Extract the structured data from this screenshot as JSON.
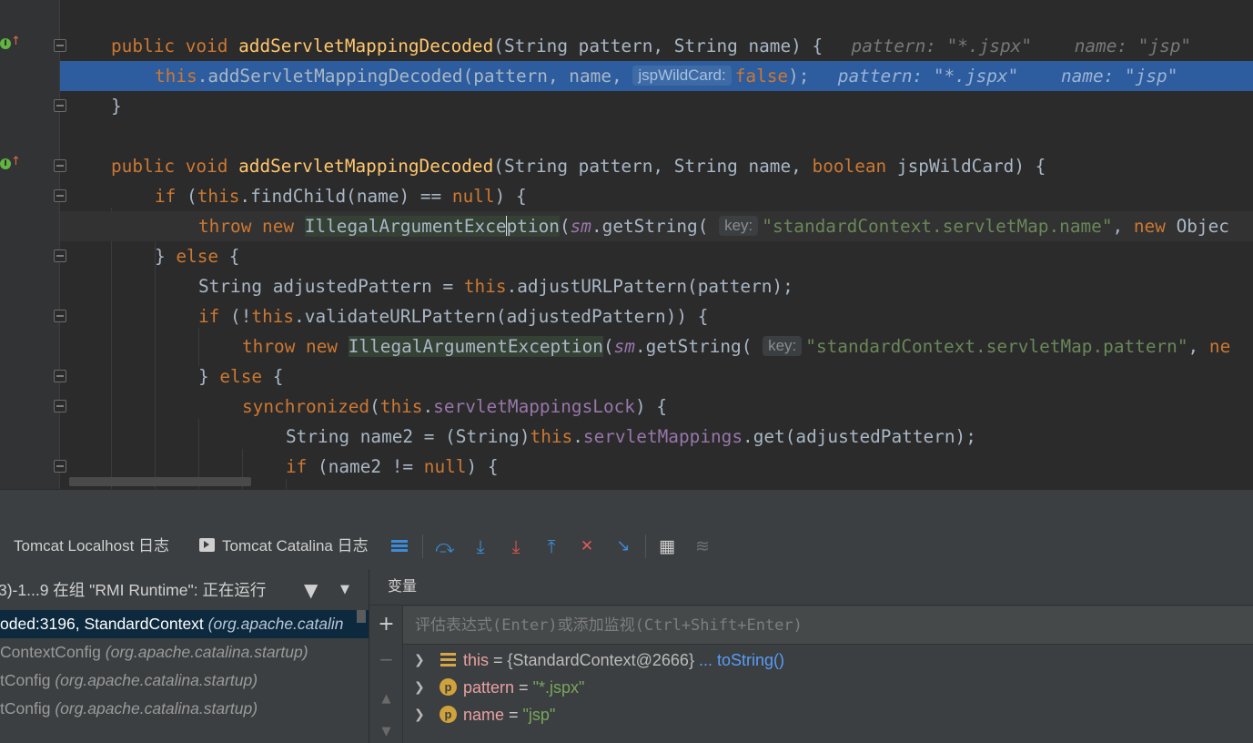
{
  "editor": {
    "lines": [
      {
        "parts": [
          [
            "kw",
            "public void "
          ],
          [
            "fn",
            "addServletMappingDecoded"
          ],
          [
            "",
            "(String pattern, String name) {  "
          ],
          [
            "inline",
            "pattern: \"*.jspx\"    name: \"jsp\""
          ]
        ]
      },
      {
        "parts": [
          [
            "kw",
            "this"
          ],
          [
            "",
            "."
          ],
          [
            "",
            "addServletMappingDecoded(pattern, name, "
          ],
          [
            "hint",
            "jspWildCard:"
          ],
          [
            "kw",
            "false"
          ],
          [
            "",
            "); "
          ],
          [
            "inline",
            " pattern: \"*.jspx\"    name: \"jsp\""
          ]
        ]
      },
      {
        "parts": [
          [
            "",
            "}"
          ]
        ]
      },
      {
        "parts": []
      },
      {
        "parts": [
          [
            "kw",
            "public void "
          ],
          [
            "fn",
            "addServletMappingDecoded"
          ],
          [
            "",
            "(String pattern, String name, "
          ],
          [
            "kw",
            "boolean "
          ],
          [
            "",
            "jspWildCard) {"
          ]
        ]
      },
      {
        "parts": [
          [
            "kw",
            "if "
          ],
          [
            "",
            "("
          ],
          [
            "kw",
            "this"
          ],
          [
            "",
            ".findChild(name) == "
          ],
          [
            "kw",
            "null"
          ],
          [
            "",
            ") {"
          ]
        ]
      },
      {
        "parts": [
          [
            "kw",
            "throw new "
          ],
          [
            "clshl",
            "IllegalArgumentExce"
          ],
          [
            "caret",
            ""
          ],
          [
            "clshl",
            "ption"
          ],
          [
            "",
            "("
          ],
          [
            "fldi",
            "sm"
          ],
          [
            "",
            ".getString( "
          ],
          [
            "hint",
            "key:"
          ],
          [
            "str",
            "\"standardContext.servletMap.name\""
          ],
          [
            "",
            ", "
          ],
          [
            "kw",
            "new "
          ],
          [
            "",
            "Objec"
          ]
        ]
      },
      {
        "parts": [
          [
            "",
            "} "
          ],
          [
            "kw",
            "else "
          ],
          [
            "",
            "{"
          ]
        ]
      },
      {
        "parts": [
          [
            "",
            "String adjustedPattern = "
          ],
          [
            "kw",
            "this"
          ],
          [
            "",
            ".adjustURLPattern(pattern);"
          ]
        ]
      },
      {
        "parts": [
          [
            "kw",
            "if "
          ],
          [
            "",
            "(!"
          ],
          [
            "kw",
            "this"
          ],
          [
            "",
            ".validateURLPattern(adjustedPattern)) {"
          ]
        ]
      },
      {
        "parts": [
          [
            "kw",
            "throw new "
          ],
          [
            "clshl",
            "IllegalArgumentException"
          ],
          [
            "",
            "("
          ],
          [
            "fldi",
            "sm"
          ],
          [
            "",
            ".getString( "
          ],
          [
            "hint",
            "key:"
          ],
          [
            "str",
            "\"standardContext.servletMap.pattern\""
          ],
          [
            "",
            ", "
          ],
          [
            "kw",
            "ne"
          ]
        ]
      },
      {
        "parts": [
          [
            "",
            "} "
          ],
          [
            "kw",
            "else "
          ],
          [
            "",
            "{"
          ]
        ]
      },
      {
        "parts": [
          [
            "kw",
            "synchronized"
          ],
          [
            "",
            "("
          ],
          [
            "kw",
            "this"
          ],
          [
            "",
            "."
          ],
          [
            "fld",
            "servletMappingsLock"
          ],
          [
            "",
            ") {"
          ]
        ]
      },
      {
        "parts": [
          [
            "",
            "String name2 = (String)"
          ],
          [
            "kw",
            "this"
          ],
          [
            "",
            "."
          ],
          [
            "fld",
            "servletMappings"
          ],
          [
            "",
            ".get(adjustedPattern);"
          ]
        ]
      },
      {
        "parts": [
          [
            "kw",
            "if "
          ],
          [
            "",
            "(name2 != "
          ],
          [
            "kw",
            "null"
          ],
          [
            "",
            ") {"
          ]
        ]
      }
    ]
  },
  "debug": {
    "tabs": {
      "localhost": "Tomcat Localhost 日志",
      "catalina": "Tomcat Catalina 日志"
    },
    "toolbar_icons": [
      "show-execution-point-icon",
      "step-over-icon",
      "step-into-icon",
      "force-step-into-icon",
      "step-out-icon",
      "drop-frame-icon",
      "run-to-cursor-icon",
      "evaluate-expression-icon",
      "trace-stream-icon"
    ],
    "thread": "3)-1...9 在组 \"RMI Runtime\": 正在运行",
    "frames": [
      {
        "method": "oded:3196, StandardContext ",
        "pkg": "(org.apache.catalin"
      },
      {
        "method": "ContextConfig ",
        "pkg": "(org.apache.catalina.startup)"
      },
      {
        "method": "tConfig ",
        "pkg": "(org.apache.catalina.startup)"
      },
      {
        "method": "tConfig ",
        "pkg": "(org.apache.catalina.startup)"
      }
    ],
    "vars_title": "变量",
    "eval_placeholder": "评估表达式(Enter)或添加监视(Ctrl+Shift+Enter)",
    "variables": [
      {
        "name": "this",
        "eq": " = ",
        "value": "{StandardContext@2666}",
        "link": " ... toString()"
      },
      {
        "name": "pattern",
        "eq": " = ",
        "value": "\"*.jspx\""
      },
      {
        "name": "name",
        "eq": " = ",
        "value": "\"jsp\""
      }
    ]
  },
  "colors": {
    "keyword": "#cc7832",
    "method": "#ffc66d",
    "string": "#6a8759",
    "field": "#9876aa",
    "selection": "#2d5d9e"
  }
}
